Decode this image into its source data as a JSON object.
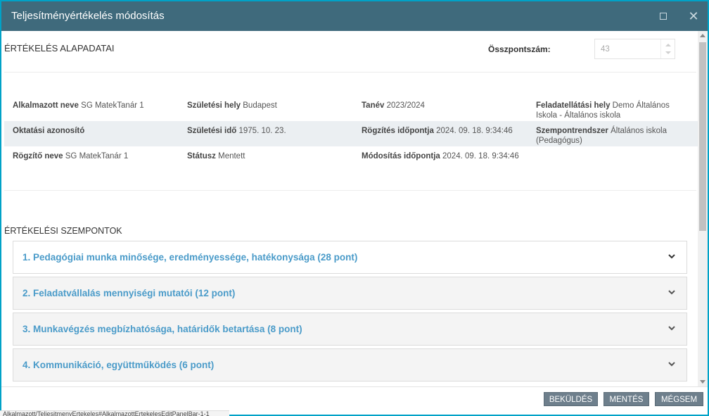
{
  "window": {
    "title": "Teljesítményértékelés módosítás",
    "maximize_icon": "maximize-icon",
    "close_icon": "close-icon",
    "close_glyph": "✕"
  },
  "basics": {
    "heading": "ÉRTÉKELÉS ALAPADATAI",
    "score_label": "Összpontszám:",
    "score_value": "43"
  },
  "info": [
    [
      {
        "label": "Alkalmazott neve",
        "value": "SG MatekTanár 1"
      },
      {
        "label": "Születési hely",
        "value": "Budapest"
      },
      {
        "label": "Tanév",
        "value": "2023/2024"
      },
      {
        "label": "Feladatellátási hely",
        "value": "Demo Általános Iskola - Általános iskola"
      }
    ],
    [
      {
        "label": "Oktatási azonosító",
        "value": ""
      },
      {
        "label": "Születési idő",
        "value": "1975. 10. 23."
      },
      {
        "label": "Rögzítés időpontja",
        "value": "2024. 09. 18. 9:34:46"
      },
      {
        "label": "Szempontrendszer",
        "value": "Általános iskola (Pedagógus)"
      }
    ],
    [
      {
        "label": "Rögzítő neve",
        "value": "SG MatekTanár 1"
      },
      {
        "label": "Státusz",
        "value": "Mentett"
      },
      {
        "label": "Módosítás időpontja",
        "value": "2024. 09. 18. 9:34:46"
      },
      {
        "label": "",
        "value": ""
      }
    ]
  ],
  "criteria": {
    "heading": "ÉRTÉKELÉSI SZEMPONTOK",
    "items": [
      "1. Pedagógiai munka minősége, eredményessége, hatékonysága (28 pont)",
      "2. Feladatvállalás mennyiségi mutatói (12 pont)",
      "3. Munkavégzés megbízhatósága, határidők betartása (8 pont)",
      "4. Kommunikáció, együttműködés (6 pont)"
    ]
  },
  "footer": {
    "submit": "BEKÜLDÉS",
    "save": "MENTÉS",
    "cancel": "MÉGSEM"
  },
  "status_url": "Alkalmazott/TeljesitmenyErtekeles#AlkalmazottErtekelesEditPanelBar-1-1",
  "colors": {
    "titlebar": "#3f6a7c",
    "border": "#00a2c7",
    "accordion_text": "#4a9bc9",
    "button": "#6e7f8c"
  }
}
